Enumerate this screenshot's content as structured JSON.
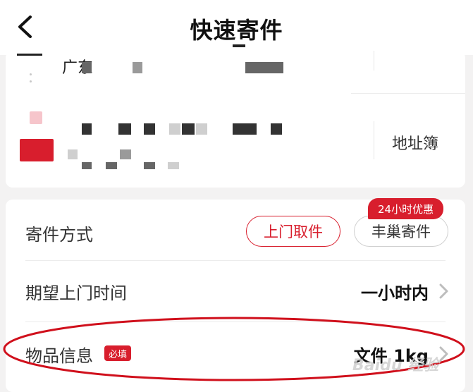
{
  "header": {
    "title": "快速寄件"
  },
  "address": {
    "sender_city": "广东",
    "address_book_label": "地址簿"
  },
  "shipping": {
    "method_label": "寄件方式",
    "pickup_label": "上门取件",
    "store_label": "丰巢寄件",
    "promo_badge": "24小时优惠",
    "pickup_time_label": "期望上门时间",
    "pickup_time_value": "一小时内",
    "item_info_label": "物品信息",
    "required_badge": "必填",
    "item_info_value": "文件 1kg"
  },
  "watermark": "Baidu 经验",
  "colors": {
    "accent": "#d81e2d",
    "annotation": "#d0101c"
  },
  "icons": {
    "back": "chevron-left-icon",
    "row_arrow": "chevron-right-icon"
  }
}
